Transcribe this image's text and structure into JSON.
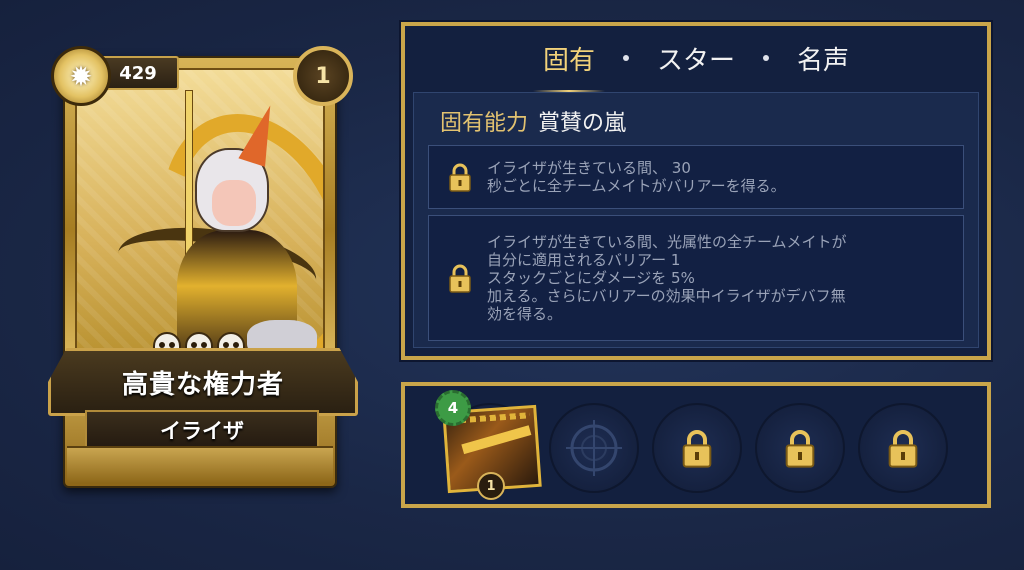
{
  "character": {
    "currency_count": "429",
    "level": "1",
    "title": "高貴な権力者",
    "name": "イライザ"
  },
  "tabs": [
    {
      "label": "固有",
      "active": true
    },
    {
      "label": "スター",
      "active": false
    },
    {
      "label": "名声",
      "active": false
    }
  ],
  "ability": {
    "label": "固有能力",
    "name": "賞賛の嵐",
    "slots": [
      {
        "text": "イライザが生きている間、 30\n秒ごとに全チームメイトがバリアーを得る。",
        "locked": true
      },
      {
        "text": "イライザが生きている間、光属性の全チームメイトが\n自分に適用されるバリアー 1\nスタックごとにダメージを 5%\n加える。さらにバリアーの効果中イライザがデバフ無\n効を得る。",
        "locked": true
      }
    ]
  },
  "skillbar": {
    "relic_gear_value": "4",
    "relic_level": "1",
    "slots": [
      "relic",
      "empty-target",
      "locked",
      "locked",
      "locked"
    ]
  },
  "colors": {
    "gold": "#c9a54a",
    "tab_active": "#f2d27a",
    "panel_bg": "#13203f",
    "background": "#1d2c4d"
  }
}
